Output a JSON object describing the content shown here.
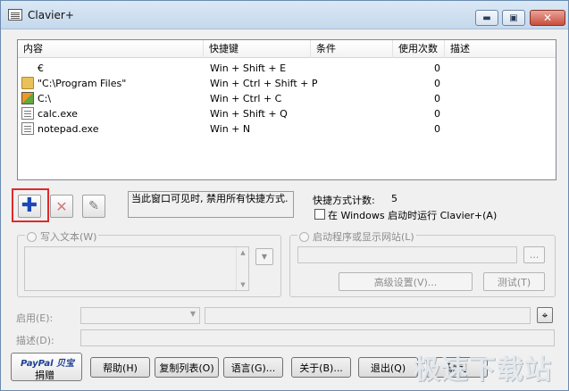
{
  "window": {
    "title": "Clavier+",
    "min_glyph": "▬",
    "max_glyph": "▣",
    "close_glyph": "✕"
  },
  "list": {
    "headers": {
      "content": "内容",
      "shortcut": "快捷键",
      "condition": "条件",
      "usage": "使用次数",
      "description": "描述"
    },
    "rows": [
      {
        "icon": "none",
        "content": "€",
        "shortcut": "Win + Shift + E",
        "usage": "0"
      },
      {
        "icon": "folder-icon",
        "content": "\"C:\\Program Files\"",
        "shortcut": "Win + Ctrl + Shift + P",
        "usage": "0"
      },
      {
        "icon": "drive-icon",
        "content": "C:\\",
        "shortcut": "Win + Ctrl + C",
        "usage": "0"
      },
      {
        "icon": "file-icon",
        "content": "calc.exe",
        "shortcut": "Win + Shift + Q",
        "usage": "0"
      },
      {
        "icon": "file-icon",
        "content": "notepad.exe",
        "shortcut": "Win + N",
        "usage": "0"
      }
    ]
  },
  "toolbar": {
    "add_glyph": "✚",
    "delete_glyph": "✕",
    "edit_glyph": "✎"
  },
  "note": "当此窗口可见时, 禁用所有快捷方式.",
  "count": {
    "label": "快捷方式计数:",
    "value": "5"
  },
  "startup_checkbox": "在 Windows 启动时运行 Clavier+(A)",
  "text_group": {
    "title": "写入文本(W)",
    "dropdown_glyph": "▼"
  },
  "launch_group": {
    "title": "启动程序或显示网站(L)",
    "browse": "...",
    "advanced": "高级设置(V)...",
    "test": "测试(T)"
  },
  "enable_label": "启用(E):",
  "describe_label": "描述(D):",
  "target_glyph": "⌖",
  "paypal": {
    "brand": "PayPal 贝宝",
    "donate": "捐赠"
  },
  "buttons": {
    "help": "帮助(H)",
    "copy_list": "复制列表(O)",
    "language": "语言(G)...",
    "about": "关于(B)...",
    "exit": "退出(Q)",
    "ok": "确定"
  },
  "watermark": "极速下载站"
}
